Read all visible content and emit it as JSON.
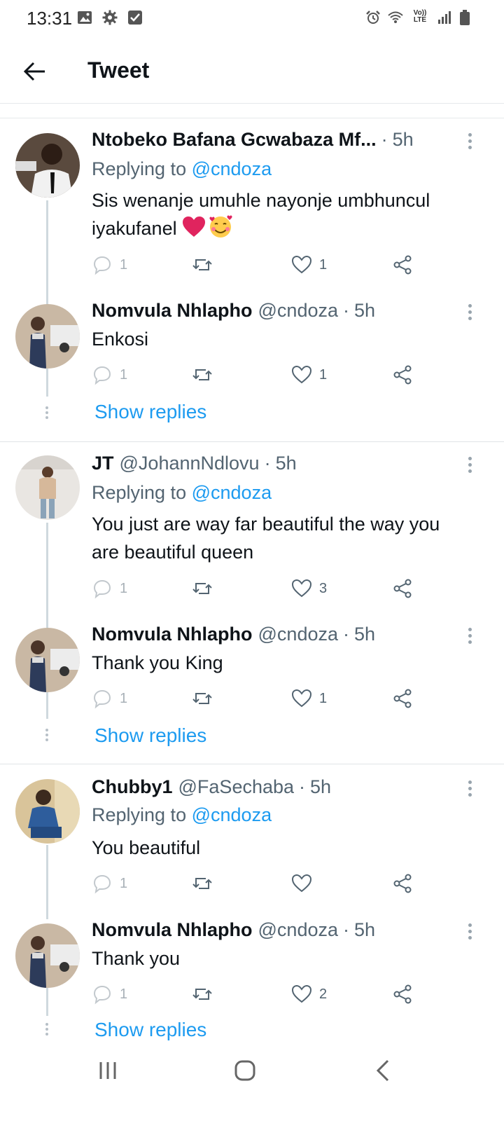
{
  "status_bar": {
    "time": "13:31",
    "lte_label": "Vo)) LTE",
    "left_icons": [
      "image-icon",
      "settings-icon",
      "checkbox-icon"
    ],
    "right_icons": [
      "alarm-icon",
      "wifi-icon",
      "lte-icon",
      "signal-icon",
      "battery-icon"
    ]
  },
  "header": {
    "title": "Tweet",
    "back_icon": "back-arrow-icon"
  },
  "threads": [
    {
      "reply": {
        "name": "Ntobeko Bafana Gcwabaza Mf...",
        "handle": "",
        "sep": "·",
        "time": "5h",
        "replying_prefix": "Replying to",
        "replying_to": "@cndoza",
        "text": "Sis wenanje umuhle nayonje umbhuncul iyakufanel",
        "emojis": [
          "red-heart",
          "smiling-face-with-hearts"
        ],
        "replies": "1",
        "retweets": "",
        "likes": "1"
      },
      "answer": {
        "name": "Nomvula Nhlapho",
        "handle": "@cndoza",
        "sep": "·",
        "time": "5h",
        "text": "Enkosi",
        "replies": "1",
        "retweets": "",
        "likes": "1"
      },
      "show_replies": "Show replies"
    },
    {
      "reply": {
        "name": "JT",
        "handle": "@JohannNdlovu",
        "sep": "·",
        "time": "5h",
        "replying_prefix": "Replying to",
        "replying_to": "@cndoza",
        "text": "You just are way far beautiful the way you are beautiful queen",
        "replies": "1",
        "retweets": "",
        "likes": "3"
      },
      "answer": {
        "name": "Nomvula Nhlapho",
        "handle": "@cndoza",
        "sep": "·",
        "time": "5h",
        "text": "Thank you King",
        "replies": "1",
        "retweets": "",
        "likes": "1"
      },
      "show_replies": "Show replies"
    },
    {
      "reply": {
        "name": "Chubby1",
        "handle": "@FaSechaba",
        "sep": "·",
        "time": "5h",
        "replying_prefix": "Replying to",
        "replying_to": "@cndoza",
        "text": "You beautiful",
        "replies": "1",
        "retweets": "",
        "likes": ""
      },
      "answer": {
        "name": "Nomvula Nhlapho",
        "handle": "@cndoza",
        "sep": "·",
        "time": "5h",
        "text": "Thank you",
        "replies": "1",
        "retweets": "",
        "likes": "2"
      },
      "show_replies": "Show replies"
    }
  ],
  "nav_bar": {
    "icons": [
      "recent-apps-icon",
      "home-icon",
      "back-icon"
    ]
  },
  "colors": {
    "accent": "#1d9bf0",
    "text_primary": "#0f1419",
    "text_secondary": "#536471",
    "like_heart_emoji": "#e0245e"
  }
}
